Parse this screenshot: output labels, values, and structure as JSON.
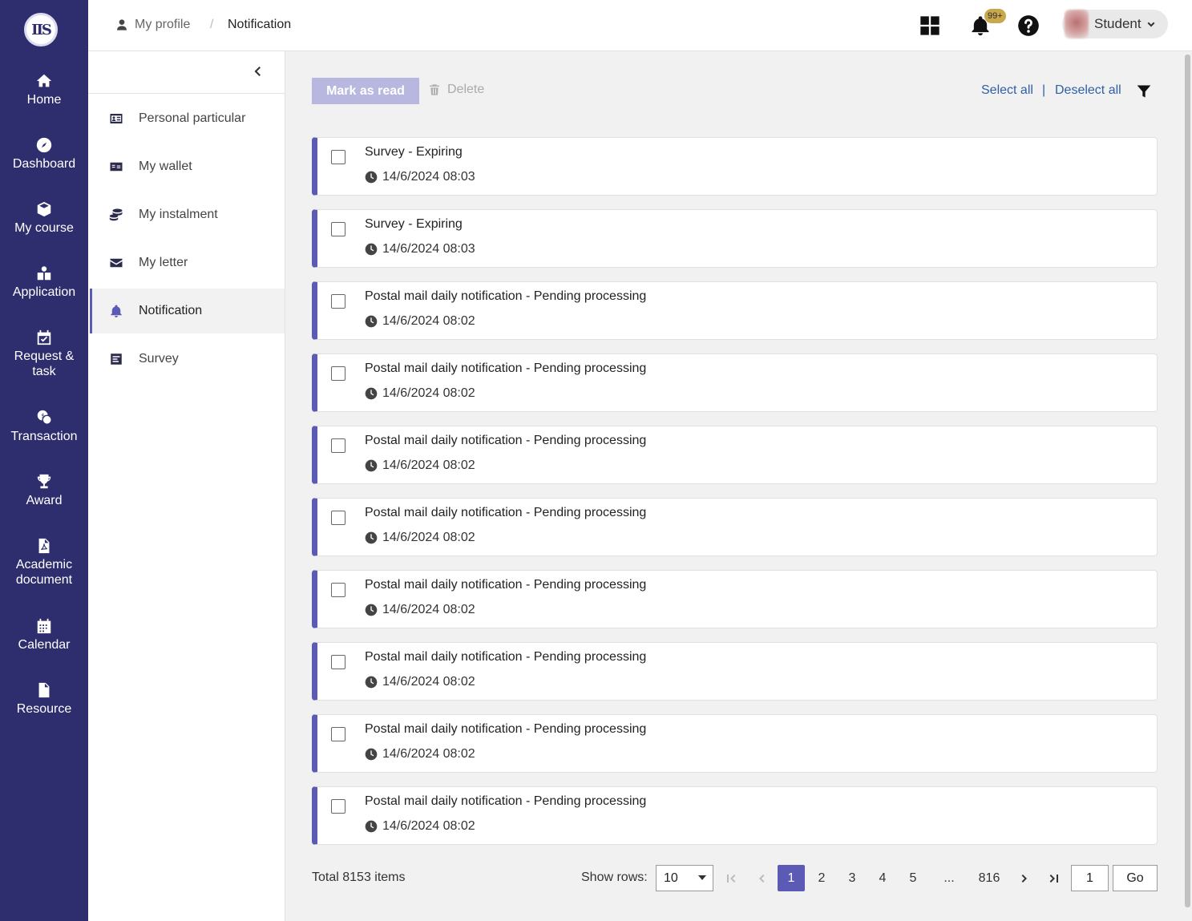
{
  "sidebar": {
    "logo_text": "IIS",
    "items": [
      {
        "label": "Home",
        "icon": "home-icon"
      },
      {
        "label": "Dashboard",
        "icon": "compass-icon"
      },
      {
        "label": "My course",
        "icon": "cube-icon"
      },
      {
        "label": "Application",
        "icon": "application-icon"
      },
      {
        "label": "Request &\ntask",
        "icon": "calendar-check-icon"
      },
      {
        "label": "Transaction",
        "icon": "transaction-icon"
      },
      {
        "label": "Award",
        "icon": "trophy-icon"
      },
      {
        "label": "Academic\ndocument",
        "icon": "pdf-icon"
      },
      {
        "label": "Calendar",
        "icon": "calendar-icon"
      },
      {
        "label": "Resource",
        "icon": "file-icon"
      }
    ]
  },
  "header": {
    "breadcrumb": {
      "profile": "My profile",
      "separator": "/",
      "current": "Notification"
    },
    "notification_badge": "99+",
    "user": {
      "name": "Student"
    }
  },
  "subnav": {
    "items": [
      {
        "label": "Personal particular",
        "icon": "id-card-icon",
        "active": false
      },
      {
        "label": "My wallet",
        "icon": "wallet-icon",
        "active": false
      },
      {
        "label": "My instalment",
        "icon": "coins-icon",
        "active": false
      },
      {
        "label": "My letter",
        "icon": "envelope-icon",
        "active": false
      },
      {
        "label": "Notification",
        "icon": "bell-icon",
        "active": true
      },
      {
        "label": "Survey",
        "icon": "survey-icon",
        "active": false
      }
    ]
  },
  "toolbar": {
    "mark_as_read": "Mark as read",
    "delete": "Delete",
    "select_all": "Select all",
    "separator": "|",
    "deselect_all": "Deselect all"
  },
  "notifications": [
    {
      "title": "Survey - Expiring",
      "time": "14/6/2024 08:03"
    },
    {
      "title": "Survey - Expiring",
      "time": "14/6/2024 08:03"
    },
    {
      "title": "Postal mail daily notification - Pending processing",
      "time": "14/6/2024 08:02"
    },
    {
      "title": "Postal mail daily notification - Pending processing",
      "time": "14/6/2024 08:02"
    },
    {
      "title": "Postal mail daily notification - Pending processing",
      "time": "14/6/2024 08:02"
    },
    {
      "title": "Postal mail daily notification - Pending processing",
      "time": "14/6/2024 08:02"
    },
    {
      "title": "Postal mail daily notification - Pending processing",
      "time": "14/6/2024 08:02"
    },
    {
      "title": "Postal mail daily notification - Pending processing",
      "time": "14/6/2024 08:02"
    },
    {
      "title": "Postal mail daily notification - Pending processing",
      "time": "14/6/2024 08:02"
    },
    {
      "title": "Postal mail daily notification - Pending processing",
      "time": "14/6/2024 08:02"
    }
  ],
  "pagination": {
    "total": "Total 8153 items",
    "show_rows_label": "Show rows:",
    "rows_value": "10",
    "pages": [
      "1",
      "2",
      "3",
      "4",
      "5"
    ],
    "ellipsis": "...",
    "last_page": "816",
    "current_page": "1",
    "goto_value": "1",
    "go_label": "Go"
  },
  "colors": {
    "sidebar_bg": "#2e2e6e",
    "accent": "#5b5bb5",
    "link": "#2f5fa8",
    "badge": "#c9a84c"
  }
}
